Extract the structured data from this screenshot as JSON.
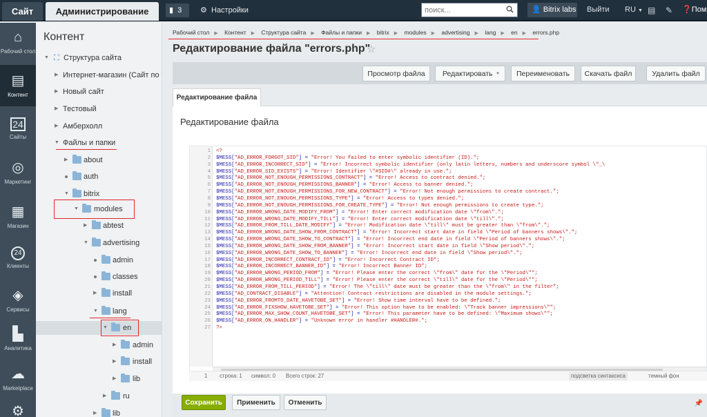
{
  "topbar": {
    "tab_site": "Сайт",
    "tab_admin": "Администрирование",
    "notifications_count": "3",
    "settings_label": "Настройки",
    "search_placeholder": "поиск...",
    "user_name": "Bitrix labs",
    "logout_label": "Выйти",
    "lang_label": "RU",
    "help_label": "Пом"
  },
  "leftnav": {
    "items": [
      {
        "label": "Рабочий стол",
        "icon": "home-icon"
      },
      {
        "label": "Контент",
        "icon": "document-icon",
        "active": true
      },
      {
        "label": "Сайты",
        "icon": "calendar-24-icon"
      },
      {
        "label": "Маркетинг",
        "icon": "target-icon"
      },
      {
        "label": "Магазин",
        "icon": "basket-icon"
      },
      {
        "label": "Клиенты",
        "icon": "clock-24-icon"
      },
      {
        "label": "Сервисы",
        "icon": "layers-icon"
      },
      {
        "label": "Аналитика",
        "icon": "bar-chart-icon"
      },
      {
        "label": "Marketplace",
        "icon": "cloud-download-icon"
      },
      {
        "label": "",
        "icon": "gear-icon"
      }
    ]
  },
  "tree": {
    "title": "Контент",
    "items": [
      {
        "label": "Структура сайта"
      },
      {
        "label": "Интернет-магазин (Сайт по умолча"
      },
      {
        "label": "Новый сайт"
      },
      {
        "label": "Тестовый"
      },
      {
        "label": "Амберхолл"
      },
      {
        "label": "Файлы и папки"
      },
      {
        "label": "about"
      },
      {
        "label": "auth"
      },
      {
        "label": "bitrix"
      },
      {
        "label": "modules"
      },
      {
        "label": "abtest"
      },
      {
        "label": "advertising"
      },
      {
        "label": "admin"
      },
      {
        "label": "classes"
      },
      {
        "label": "install"
      },
      {
        "label": "lang"
      },
      {
        "label": "en"
      },
      {
        "label": "admin"
      },
      {
        "label": "install"
      },
      {
        "label": "lib"
      },
      {
        "label": "ru"
      },
      {
        "label": "lib"
      }
    ]
  },
  "breadcrumb": [
    "Рабочий стол",
    "Контент",
    "Структура сайта",
    "Файлы и папки",
    "bitrix",
    "modules",
    "advertising",
    "lang",
    "en",
    "errors.php"
  ],
  "page": {
    "title": "Редактирование файла \"errors.php\"",
    "tab_label": "Редактирование файла",
    "section_title": "Редактирование файла"
  },
  "toolbar": {
    "view": "Просмотр файла",
    "edit": "Редактировать",
    "rename": "Переименовать",
    "download": "Скачать файл",
    "delete": "Удалить файл"
  },
  "editor": {
    "lines": [
      "<?",
      "$MESS[\"AD_ERROR_FORGOT_SID\"] = \"Error! You failed to enter symbolic identifier (ID).\";",
      "$MESS[\"AD_ERROR_INCORRECT_SID\"] = \"Error! Incorrect symbolic identifier (only latin letters, numbers and underscore symbol \\\"_\\",
      "$MESS[\"AD_ERROR_SID_EXISTS\"] = \"Error! Identifier \\\"#SID#\\\" already in use.\";",
      "$MESS[\"AD_ERROR_NOT_ENOUGH_PERMISSIONS_CONTRACT\"] = \"Error! Access to contract denied.\";",
      "$MESS[\"AD_ERROR_NOT_ENOUGH_PERMISSIONS_BANNER\"] = \"Error! Access to banner denied.\";",
      "$MESS[\"AD_ERROR_NOT_ENOUGH_PERMISSIONS_FOR_NEW_CONTRACT\"] = \"Error! Not enough permissions to create contract.\";",
      "$MESS[\"AD_ERROR_NOT_ENOUGH_PERMISSIONS_TYPE\"] = \"Error! Access to types denied.\";",
      "$MESS[\"AD_ERROR_NOT_ENOUGH_PERMISSIONS_FOR_CREATE_TYPE\"] = \"Error! Not enough permissions to create type.\";",
      "$MESS[\"AD_ERROR_WRONG_DATE_MODIFY_FROM\"] = \"Error! Enter correct modification date \\\"from\\\".\";",
      "$MESS[\"AD_ERROR_WRONG_DATE_MODIFY_TILL\"] = \"Error! Enter correct modification date \\\"till\\\".\";",
      "$MESS[\"AD_ERROR_FROM_TILL_DATE_MODIFY\"] = \"Error! Modification date \\\"till\\\" must be greater than \\\"from\\\".\";",
      "$MESS[\"AD_ERROR_WRONG_DATE_SHOW_FROM_CONTRACT\"] = \"Error! Incorrect start date in field \\\"Period of banners shows\\\".\";",
      "$MESS[\"AD_ERROR_WRONG_DATE_SHOW_TO_CONTRACT\"] = \"Error! Incorrect end date in field \\\"Period of banners shows\\\".\";",
      "$MESS[\"AD_ERROR_WRONG_DATE_SHOW_FROM_BANNER\"] = \"Error! Incorrect start date in field \\\"Show period\\\".\";",
      "$MESS[\"AD_ERROR_WRONG_DATE_SHOW_TO_BANNER\"] = \"Error! Incorrect end date in field \\\"Show period\\\".\";",
      "$MESS[\"AD_ERROR_INCORRECT_CONTRACT_ID\"] = \"Error! Incorrect Contract ID\";",
      "$MESS[\"AD_ERROR_INCORRECT_BANNER_ID\"] = \"Error! Incorrect Banner ID\";",
      "$MESS[\"AD_ERROR_WRONG_PERIOD_FROM\"] = \"Error! Please enter the correct \\\"from\\\" date for the \\\"Period\\\"\";",
      "$MESS[\"AD_ERROR_WRONG_PERIOD_TILL\"] = \"Error! Please enter the correct \\\"till\\\" date for the \\\"Period\\\"\";",
      "$MESS[\"AD_ERROR_FROM_TILL_PERIOD\"] = \"Error! The \\\"till\\\" date must be greater than the \\\"from\\\" in the filter\";",
      "$MESS[\"AD_CONTRACT_DISABLE\"] = \"Attention! Contract restrictions are disabled in the module settings.\";",
      "$MESS[\"AD_ERROR_FROMTO_DATE_HAVETOBE_SET\"] = \"Error! Show time interval have to be defined.\";",
      "$MESS[\"AD_ERROR_FIXSHOW_HAVETOBE_SET\"] = \"Error! This option have to be enabled: \\\"Track banner impressions\\\"\";",
      "$MESS[\"AD_ERROR_MAX_SHOW_COUNT_HAVETOBE_SET\"] = \"Error! This parameter have to be defined: \\\"Maximum shows\\\"\";",
      "$MESS[\"AD_ERROR_ON_HANDLER\"] = \"Unknown error in handler #HANDLER#.\";",
      "?>"
    ],
    "status": {
      "cursor_line": "1",
      "row": "строка: 1",
      "col": "символ: 0",
      "total": "Всего строк: 27",
      "highlight": "подсветка синтаксиса",
      "theme": "темный фон"
    }
  },
  "footer": {
    "save": "Сохранить",
    "apply": "Применить",
    "cancel": "Отменить"
  },
  "colors": {
    "topbar": "#21303d",
    "leftnav": "#3e4d59",
    "save_green": "#86ad00",
    "annotation_red": "#e5242b"
  }
}
